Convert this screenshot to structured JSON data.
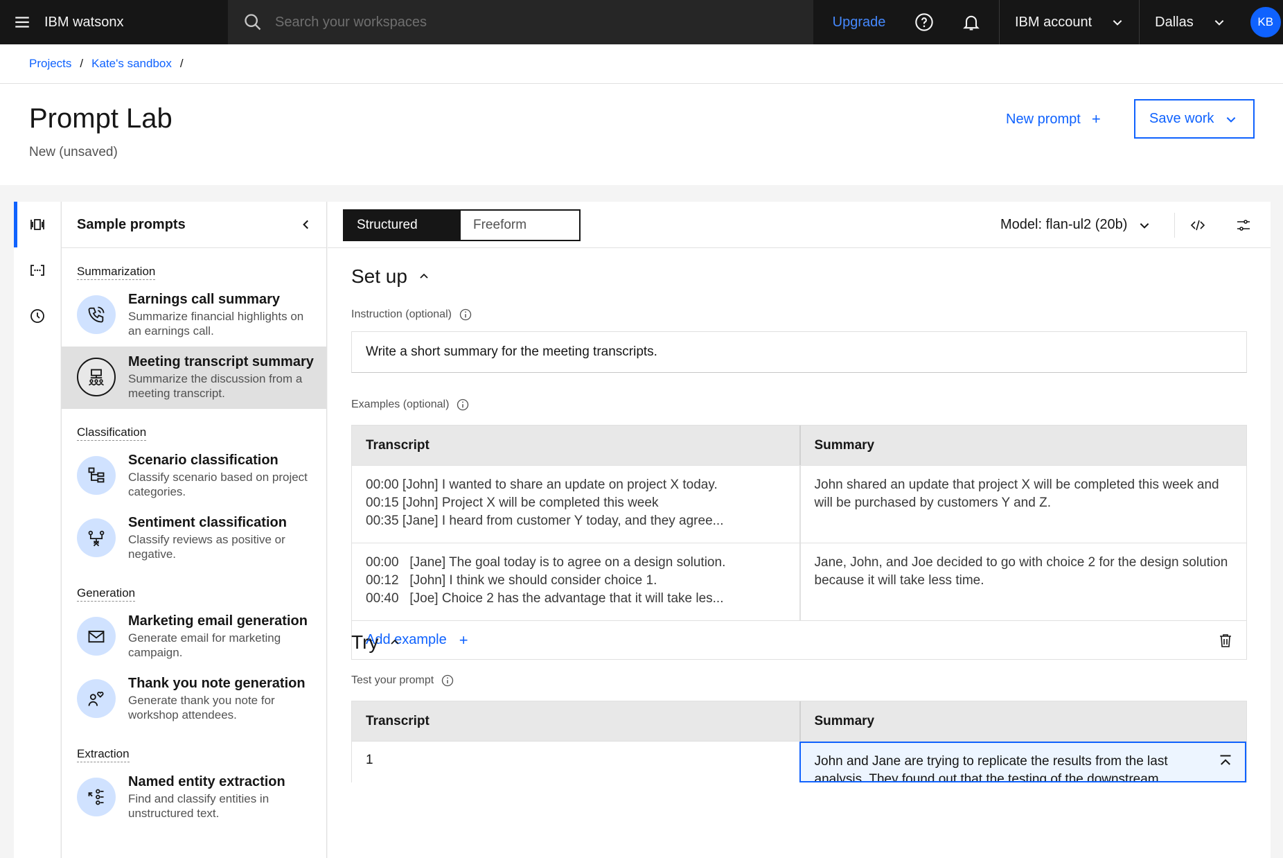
{
  "topbar": {
    "brand": "IBM watsonx",
    "search_placeholder": "Search your workspaces",
    "upgrade": "Upgrade",
    "account": "IBM account",
    "region": "Dallas",
    "avatar": "KB"
  },
  "breadcrumb": [
    "Projects",
    "Kate's sandbox"
  ],
  "page": {
    "title": "Prompt Lab",
    "subtitle": "New (unsaved)",
    "new_prompt": "New prompt",
    "save_work": "Save work"
  },
  "sample_panel": {
    "title": "Sample prompts",
    "categories": [
      {
        "name": "Summarization",
        "items": [
          {
            "title": "Earnings call summary",
            "desc": "Summarize financial highlights on an earnings call.",
            "icon": "phone-icon"
          },
          {
            "title": "Meeting transcript summary",
            "desc": "Summarize the discussion from a meeting transcript.",
            "icon": "meeting-icon",
            "selected": true
          }
        ]
      },
      {
        "name": "Classification",
        "items": [
          {
            "title": "Scenario classification",
            "desc": "Classify scenario based on project categories.",
            "icon": "hierarchy-icon"
          },
          {
            "title": "Sentiment classification",
            "desc": "Classify reviews as positive or negative.",
            "icon": "sentiment-icon"
          }
        ]
      },
      {
        "name": "Generation",
        "items": [
          {
            "title": "Marketing email generation",
            "desc": "Generate email for marketing campaign.",
            "icon": "email-icon"
          },
          {
            "title": "Thank you note generation",
            "desc": "Generate thank you note for workshop attendees.",
            "icon": "user-heart-icon"
          }
        ]
      },
      {
        "name": "Extraction",
        "items": [
          {
            "title": "Named entity extraction",
            "desc": "Find and classify entities in unstructured text.",
            "icon": "entity-icon"
          }
        ]
      }
    ]
  },
  "editor": {
    "mode_structured": "Structured",
    "mode_freeform": "Freeform",
    "model": "Model: flan-ul2 (20b)",
    "setup_title": "Set up",
    "instruction_label": "Instruction (optional)",
    "instruction_value": "Write a short summary for the meeting transcripts.",
    "examples_label": "Examples (optional)",
    "col_transcript": "Transcript",
    "col_summary": "Summary",
    "examples": [
      {
        "transcript": [
          "00:00 [John] I wanted to share an update on project X today.",
          "00:15 [John] Project X will be completed this week",
          "00:35 [Jane] I heard from customer Y today, and they agree..."
        ],
        "summary": "John shared an update that project X will be completed this week and will be purchased by customers Y and Z."
      },
      {
        "transcript": [
          "00:00   [Jane] The goal today is to agree on a design solution.",
          "00:12   [John] I think we should consider choice 1.",
          "00:40   [Joe] Choice 2 has the advantage that it will take les..."
        ],
        "summary": "Jane, John, and Joe decided to go with choice 2 for the design solution because it will take less time."
      }
    ],
    "add_example": "Add example",
    "try_title": "Try",
    "test_label": "Test your prompt",
    "try_row": {
      "transcript": "1",
      "summary": "John and Jane are trying to replicate the results from the last analysis. They found out that the testing of the downstream"
    }
  }
}
